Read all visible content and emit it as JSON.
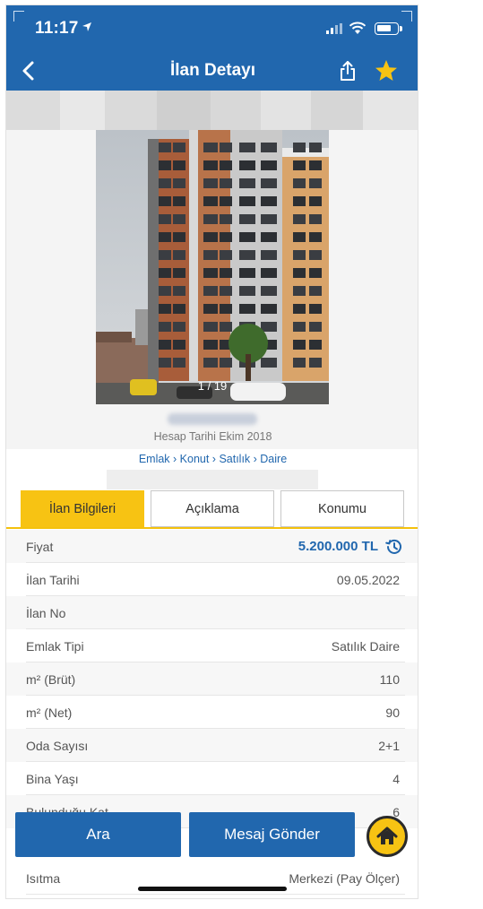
{
  "status_bar": {
    "time": "11:17"
  },
  "header": {
    "title": "İlan Detayı",
    "bar_color": "#2167ae",
    "favorite_color": "#f7c313"
  },
  "photo": {
    "counter": "1 / 19"
  },
  "seller": {
    "account_date": "Hesap Tarihi  Ekim 2018"
  },
  "breadcrumb": "Emlak › Konut › Satılık › Daire",
  "tabs": [
    {
      "label": "İlan Bilgileri",
      "active": true
    },
    {
      "label": "Açıklama",
      "active": false
    },
    {
      "label": "Konumu",
      "active": false
    }
  ],
  "info": [
    {
      "label": "Fiyat",
      "value": "5.200.000 TL"
    },
    {
      "label": "İlan Tarihi",
      "value": "09.05.2022"
    },
    {
      "label": "İlan No",
      "value": ""
    },
    {
      "label": "Emlak Tipi",
      "value": "Satılık Daire"
    },
    {
      "label": "m² (Brüt)",
      "value": "110"
    },
    {
      "label": "m² (Net)",
      "value": "90"
    },
    {
      "label": "Oda Sayısı",
      "value": "2+1"
    },
    {
      "label": "Bina Yaşı",
      "value": "4"
    },
    {
      "label": "Bulunduğu Kat",
      "value": "6"
    },
    {
      "label": "Isıtma",
      "value": "Merkezi (Pay Ölçer)"
    }
  ],
  "actions": {
    "call": "Ara",
    "message": "Mesaj Gönder"
  },
  "icons": {
    "back": "chevron-left-icon",
    "share": "share-icon",
    "favorite": "star-icon",
    "price_history": "history-icon",
    "home": "home-icon"
  }
}
